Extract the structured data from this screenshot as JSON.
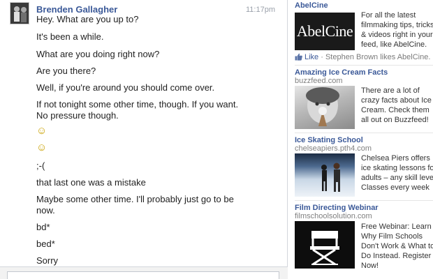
{
  "chat": {
    "sender": "Brenden Gallagher",
    "time": "11:17pm",
    "messages": [
      "Hey. What are you up to?",
      "It's been a while.",
      "What are you doing right now?",
      "Are you there?",
      "Well, if you're around you should come over.",
      "If not tonight some other time, though. If you want.",
      "No pressure though.",
      "☺",
      "☺",
      ";-(",
      "that last one was a mistake",
      "Maybe some other time. I'll probably just go to be",
      "now.",
      "bd*",
      "bed*",
      "Sorry"
    ]
  },
  "ads": [
    {
      "title": "AbelCine",
      "image_text": "AbelCine",
      "body": "For all the latest filmmaking tips, tricks & videos right in your feed, like AbelCine.",
      "like_link": "Like",
      "like_text": " · Stephen Brown likes AbelCine."
    },
    {
      "title": "Amazing Ice Cream Facts",
      "domain": "buzzfeed.com",
      "body": "There are a lot of crazy facts about Ice Cream. Check them all out on Buzzfeed!"
    },
    {
      "title": "Ice Skating School",
      "domain": "chelseapiers.pth4.com",
      "body": "Chelsea Piers offers ice skating lessons for adults – any skill level. Classes every week"
    },
    {
      "title": "Film Directing Webinar",
      "domain": "filmschoolsolution.com",
      "body": "Free Webinar: Learn Why Film Schools Don't Work & What to Do Instead. Register Now!"
    }
  ],
  "colors": {
    "link": "#3b5998",
    "text": "#1f1f1f",
    "muted": "#808080",
    "border": "#d3d6db"
  },
  "icons": {
    "avatar": "profile-photo",
    "like": "thumbs-up-icon",
    "film": "director-chair-icon"
  }
}
